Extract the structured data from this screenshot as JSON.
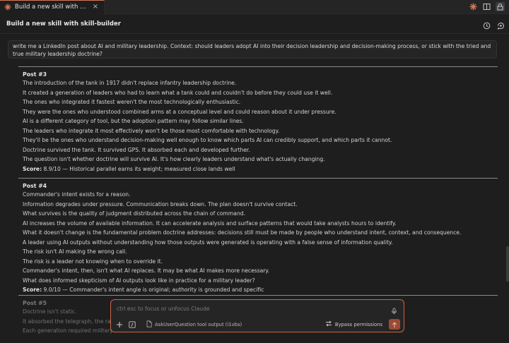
{
  "tab": {
    "label": "Build a new skill with s…",
    "close": "×"
  },
  "header": {
    "title": "Build a new skill with skill-builder"
  },
  "user_message": "write me a LinkedIn post about AI and military leadership. Context: should leaders adopt AI into their decision leadership and decision-making process, or stick with the tried and true military leadership doctrine?",
  "posts": [
    {
      "title": "Post #3",
      "lines": [
        "The introduction of the tank in 1917 didn't replace infantry leadership doctrine.",
        "It created a generation of leaders who had to learn what a tank could and couldn't do before they could use it well.",
        "The ones who integrated it fastest weren't the most technologically enthusiastic.",
        "They were the ones who understood combined arms at a conceptual level and could reason about it under pressure.",
        "AI is a different category of tool, but the adoption pattern may follow similar lines.",
        "The leaders who integrate it most effectively won't be those most comfortable with technology.",
        "They'll be the ones who understand decision-making well enough to know which parts AI can credibly support, and which parts it cannot.",
        "Doctrine survived the tank. It survived GPS. It absorbed each and developed further.",
        "The question isn't whether doctrine will survive AI. It's how clearly leaders understand what's actually changing."
      ],
      "score_label": "Score:",
      "score_text": " 8.9/10 — Historical parallel earns its weight; measured close lands well"
    },
    {
      "title": "Post #4",
      "lines": [
        "Commander's intent exists for a reason.",
        "Information degrades under pressure. Communication breaks down. The plan doesn't survive contact.",
        "What survives is the quality of judgment distributed across the chain of command.",
        "AI increases the volume of available information. It can accelerate analysis and surface patterns that would take analysts hours to identify.",
        "What it doesn't change is the fundamental problem doctrine addresses: decisions still must be made by people who understand intent, context, and consequence.",
        "A leader using AI outputs without understanding how those outputs were generated is operating with a false sense of information quality.",
        "The risk isn't AI making the wrong call.",
        "The risk is a leader not knowing when to override it.",
        "Commander's intent, then, isn't what AI replaces. It may be what AI makes more necessary.",
        "What does informed skepticism of AI outputs look like in practice for a military leader?"
      ],
      "score_label": "Score:",
      "score_text": " 9.0/10 — Commander's intent angle is original; authority is grounded and specific"
    },
    {
      "title": "Post #5",
      "lines": [
        "Doctrine isn't static.",
        "It absorbed the telegraph, the radio",
        "Each generation required military l"
      ]
    }
  ],
  "input": {
    "placeholder": "ctrl esc to focus or unfocus Claude",
    "file_ref": "AskUserQuestion tool output (i1vbs)",
    "bypass": "Bypass permissions"
  },
  "colors": {
    "accent": "#d97757",
    "border_accent": "#c96442",
    "send": "#9b4a33"
  },
  "icons": [
    "claude-logo-icon",
    "close-icon",
    "sparkle-icon",
    "split-editor-icon",
    "lock-icon",
    "history-icon",
    "new-chat-icon",
    "microphone-icon",
    "plus-icon",
    "slash-command-icon",
    "file-icon",
    "bypass-icon",
    "send-icon"
  ]
}
